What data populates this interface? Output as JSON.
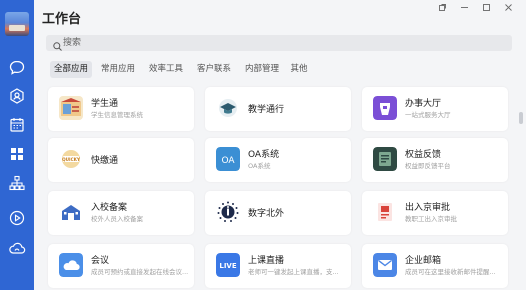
{
  "header": {
    "title": "工作台"
  },
  "search": {
    "placeholder": "搜索"
  },
  "tabs": [
    {
      "label": "全部应用",
      "active": true
    },
    {
      "label": "常用应用"
    },
    {
      "label": "效率工具"
    },
    {
      "label": "客户联系"
    },
    {
      "label": "内部管理"
    },
    {
      "label": "其他"
    }
  ],
  "apps": [
    {
      "name": "学生通",
      "desc": "学生信息管理系统",
      "icon": "student-icon"
    },
    {
      "name": "教学通行",
      "desc": "",
      "icon": "graduation-cap-icon"
    },
    {
      "name": "办事大厅",
      "desc": "一站式服务大厅",
      "icon": "service-hall-icon"
    },
    {
      "name": "快缴通",
      "desc": "",
      "icon": "quick-pay-icon"
    },
    {
      "name": "OA系统",
      "desc": "OA系统",
      "icon": "oa-icon"
    },
    {
      "name": "权益反馈",
      "desc": "权益即反馈平台",
      "icon": "feedback-icon"
    },
    {
      "name": "入校备案",
      "desc": "校外人员入校备案",
      "icon": "campus-entry-icon"
    },
    {
      "name": "数字北外",
      "desc": "",
      "icon": "digital-bfsu-icon"
    },
    {
      "name": "出入京审批",
      "desc": "教职工出入京审批",
      "icon": "travel-approval-icon"
    },
    {
      "name": "会议",
      "desc": "成员可预约或直接发起在线会议...",
      "icon": "cloud-meeting-icon"
    },
    {
      "name": "上课直播",
      "desc": "老师可一键发起上课直播，支...",
      "icon": "live-icon"
    },
    {
      "name": "企业邮箱",
      "desc": "成员可在这里接收新邮件提醒...",
      "icon": "mail-icon"
    }
  ],
  "colors": {
    "sidebar": "#2f66d3",
    "accent": "#3a73d9"
  }
}
